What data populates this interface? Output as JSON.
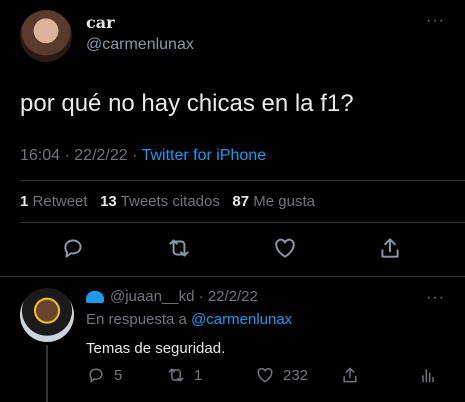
{
  "tweet": {
    "display_name": "car",
    "handle": "@carmenlunax",
    "more": "···",
    "text": "por qué no hay chicas en la f1?",
    "time": "16:04",
    "date": "22/2/22",
    "separator": " · ",
    "source": "Twitter for iPhone",
    "stats": {
      "retweets_count": "1",
      "retweets_label": "Retweet",
      "quotes_count": "13",
      "quotes_label": "Tweets citados",
      "likes_count": "87",
      "likes_label": "Me gusta"
    }
  },
  "reply": {
    "handle": "@juaan__kd",
    "date": "22/2/22",
    "separator": " · ",
    "more": "···",
    "reply_to_label": "En respuesta a",
    "reply_to_handle": "@carmenlunax",
    "text": "Temas de seguridad.",
    "replies_count": "5",
    "retweets_count": "1",
    "likes_count": "232"
  },
  "icons": {
    "reply": "reply-icon",
    "retweet": "retweet-icon",
    "like": "heart-icon",
    "share": "share-icon",
    "analytics": "analytics-icon"
  },
  "colors": {
    "background": "#000000",
    "text": "#e7e9ea",
    "muted": "#71767b",
    "accent": "#1d9bf0"
  }
}
